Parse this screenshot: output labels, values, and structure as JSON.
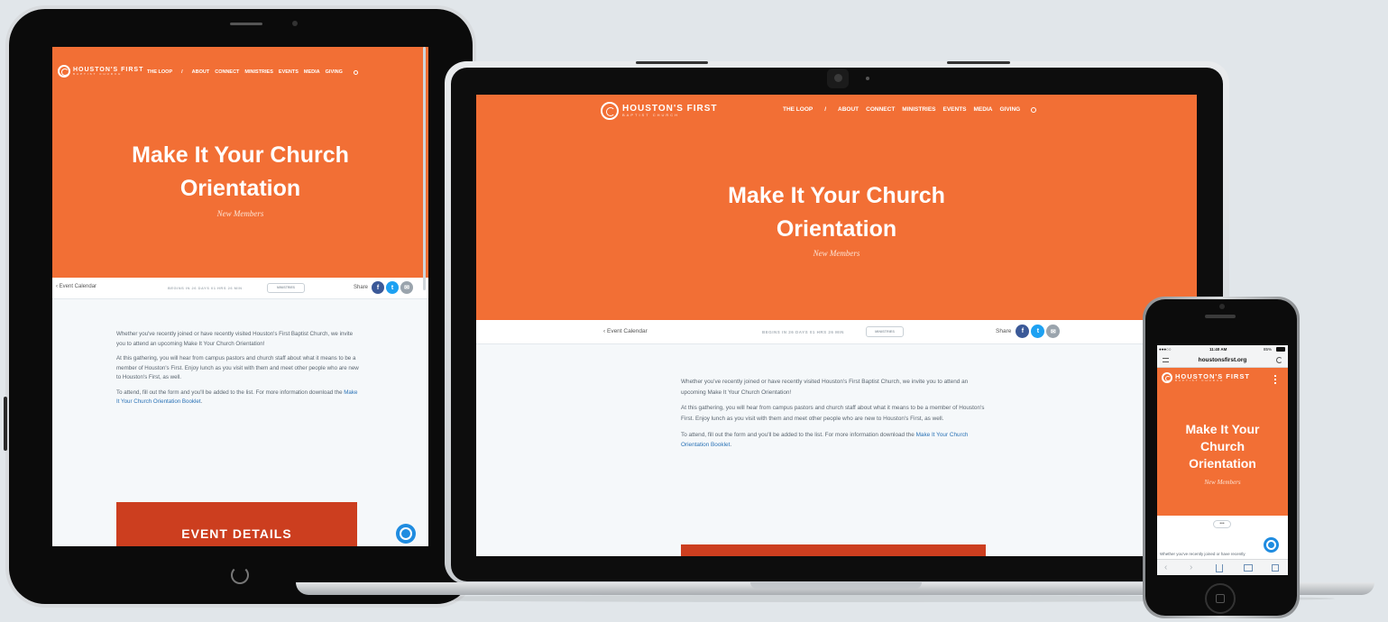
{
  "site": {
    "logo_name": "HOUSTON'S FIRST",
    "logo_sub": "BAPTIST CHURCH",
    "nav": [
      "THE LOOP",
      "/",
      "ABOUT",
      "CONNECT",
      "MINISTRIES",
      "EVENTS",
      "MEDIA",
      "GIVING"
    ]
  },
  "event": {
    "title_line1": "Make It Your Church",
    "title_line2": "Orientation",
    "subtitle": "New Members",
    "back_label": "Event Calendar",
    "countdown": "BEGINS IN 26 DAYS 01 HRS 26 MIN",
    "tag": "MINISTRIES",
    "share_label": "Share",
    "share_icons": [
      "f",
      "t",
      "✉"
    ],
    "paragraph1": "Whether you've recently joined or have recently visited Houston's First Baptist Church, we invite you to attend an upcoming Make It Your Church Orientation!",
    "paragraph2": "At this gathering, you will hear from campus pastors and church staff about what it means to be a member of Houston's First. Enjoy lunch as you visit with them and meet other people who are new to Houston's First, as well.",
    "paragraph3_prefix": "To attend, fill out the form and you'll be added to the list. For more information download the",
    "booklet_link": "Make It Your Church Orientation Booklet",
    "details_button": "EVENT DETAILS"
  },
  "phone": {
    "carrier": "●●●○○",
    "time": "11:40 AM",
    "battery": "85%",
    "url": "houstonsfirst.org",
    "title_line1": "Make It Your",
    "title_line2": "Church",
    "title_line3": "Orientation",
    "more_label": "•••",
    "snippet": "Whether you've recently joined or have recently"
  },
  "colors": {
    "hero": "#f26f35",
    "cta": "#cc3e1f",
    "link": "#2a72b6",
    "chat": "#1f8ce0"
  }
}
